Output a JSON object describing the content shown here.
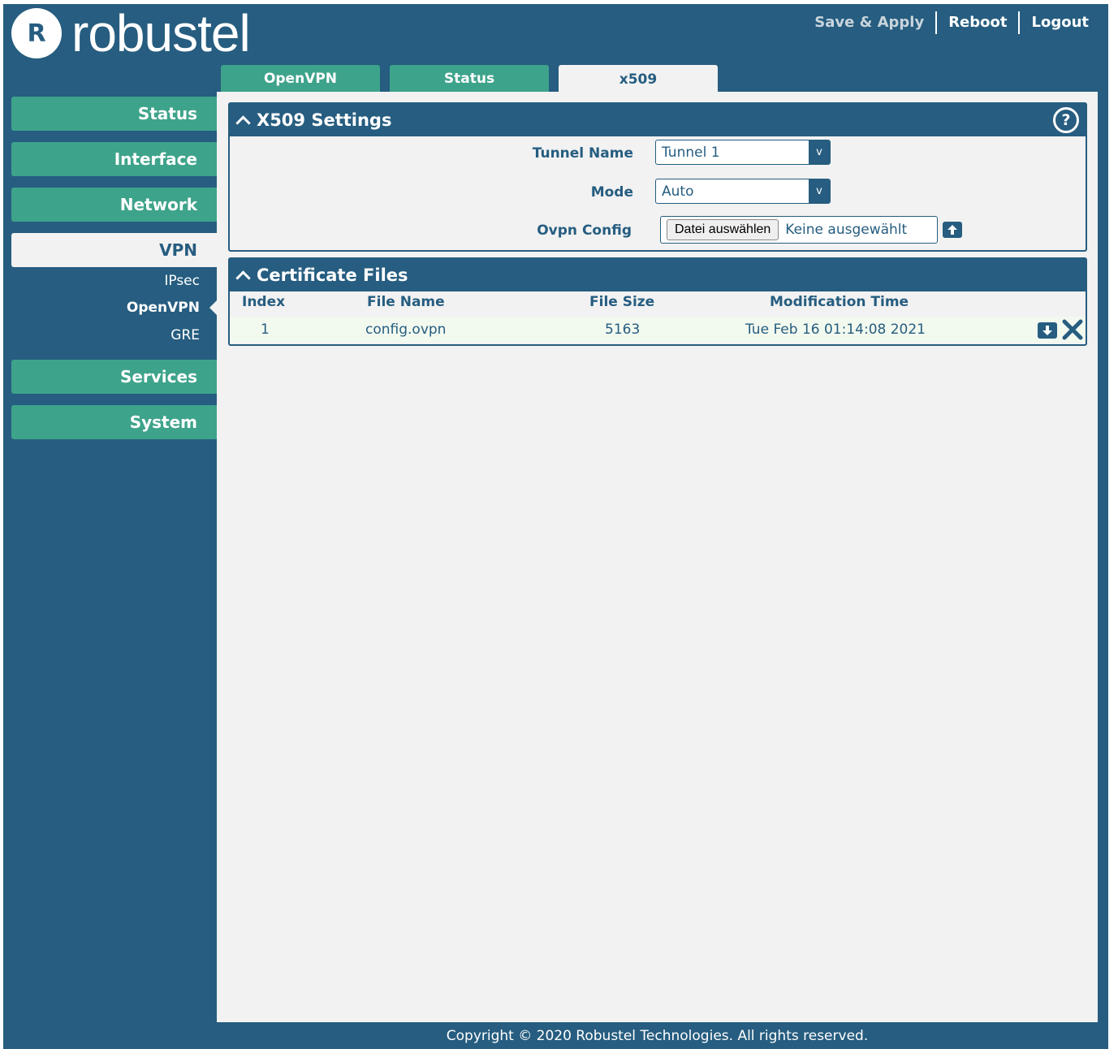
{
  "brand": {
    "logo_mark": "R",
    "name": "robustel"
  },
  "top_actions": {
    "save_apply": "Save & Apply",
    "reboot": "Reboot",
    "logout": "Logout"
  },
  "tabs": [
    {
      "label": "OpenVPN",
      "active": false
    },
    {
      "label": "Status",
      "active": false
    },
    {
      "label": "x509",
      "active": true
    }
  ],
  "sidebar": {
    "status": "Status",
    "interface": "Interface",
    "network": "Network",
    "vpn": "VPN",
    "vpn_sub": [
      "IPsec",
      "OpenVPN",
      "GRE"
    ],
    "services": "Services",
    "system": "System"
  },
  "x509_settings": {
    "title": "X509 Settings",
    "help_icon": "?",
    "tunnel_name_label": "Tunnel Name",
    "tunnel_name_value": "Tunnel 1",
    "mode_label": "Mode",
    "mode_value": "Auto",
    "ovpn_config_label": "Ovpn Config",
    "file_button": "Datei auswählen",
    "file_status": "Keine ausgewählt",
    "select_arrow": "v"
  },
  "certificate_files": {
    "title": "Certificate Files",
    "columns": [
      "Index",
      "File Name",
      "File Size",
      "Modification Time"
    ],
    "rows": [
      {
        "index": "1",
        "file_name": "config.ovpn",
        "file_size": "5163",
        "modification_time": "Tue Feb 16 01:14:08 2021"
      }
    ]
  },
  "footer": "Copyright © 2020 Robustel Technologies. All rights reserved.",
  "colors": {
    "primary": "#265d80",
    "accent": "#3ea38b",
    "background": "#f2f2f2"
  }
}
